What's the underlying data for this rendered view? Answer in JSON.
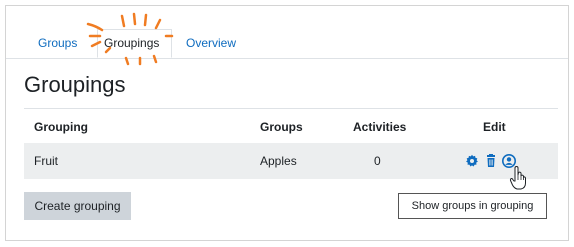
{
  "tabs": [
    {
      "label": "Groups",
      "active": false
    },
    {
      "label": "Groupings",
      "active": true
    },
    {
      "label": "Overview",
      "active": false
    }
  ],
  "page_title": "Groupings",
  "table": {
    "headers": {
      "grouping": "Grouping",
      "groups": "Groups",
      "activities": "Activities",
      "edit": "Edit"
    },
    "rows": [
      {
        "grouping": "Fruit",
        "groups": "Apples",
        "activities": "0",
        "edit_icons": [
          "settings-icon",
          "delete-icon",
          "show-groups-icon"
        ]
      }
    ]
  },
  "create_button_label": "Create grouping",
  "tooltip": "Show groups in grouping",
  "colors": {
    "link": "#0f6cbf",
    "icon": "#0f6cbf",
    "highlight_scribble": "#f07c22",
    "row_bg": "#eceeef",
    "button_bg": "#ced4da"
  }
}
